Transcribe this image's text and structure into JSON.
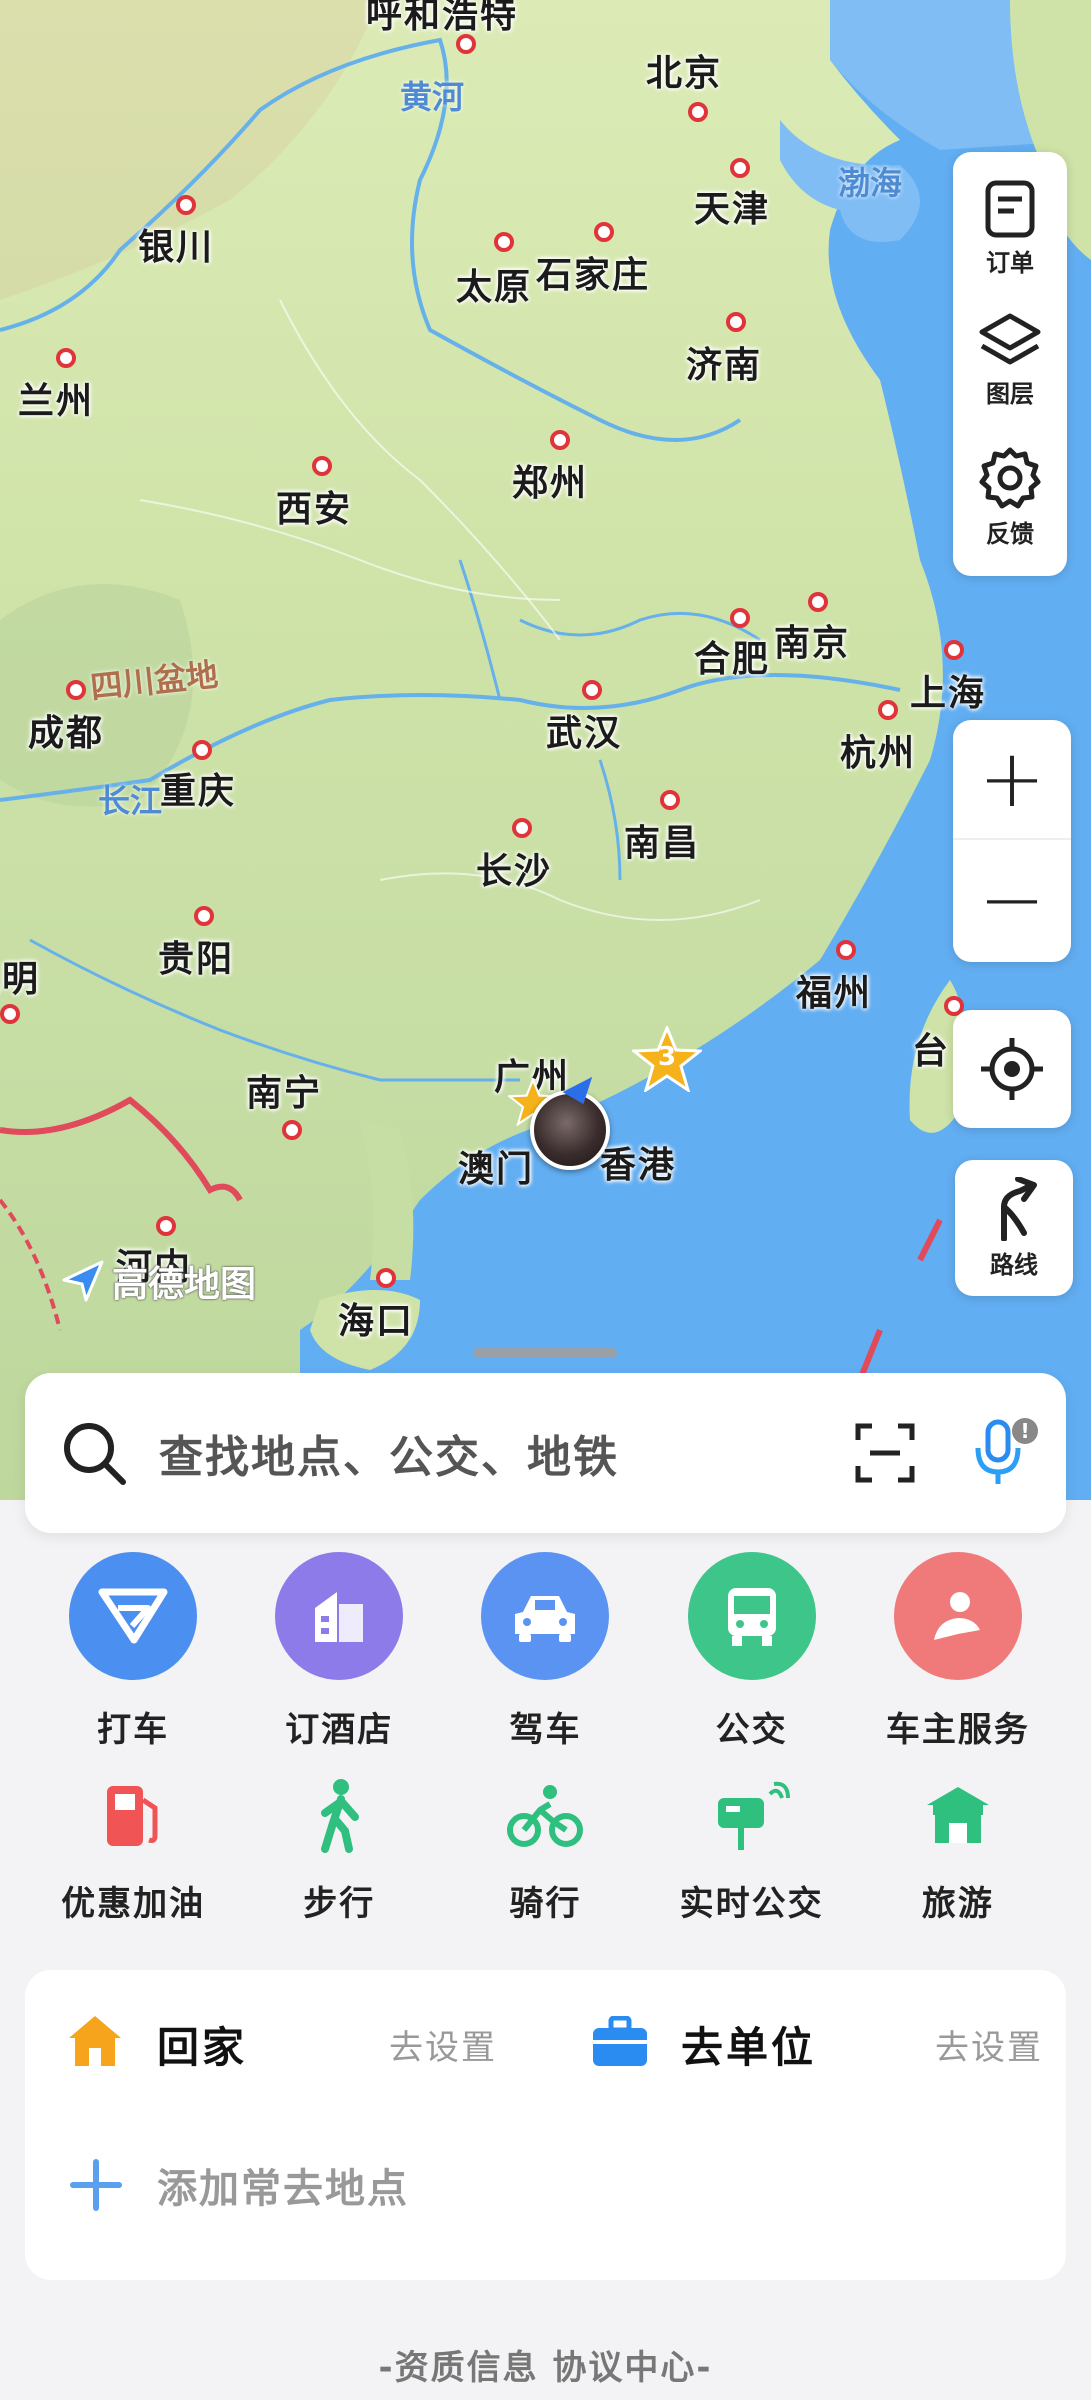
{
  "map": {
    "cities": [
      {
        "id": "huhehaote",
        "name": "呼和浩特"
      },
      {
        "id": "beijing",
        "name": "北京"
      },
      {
        "id": "tianjin",
        "name": "天津"
      },
      {
        "id": "yinchuan",
        "name": "银川"
      },
      {
        "id": "taiyuan",
        "name": "太原"
      },
      {
        "id": "shijiazhuang",
        "name": "石家庄"
      },
      {
        "id": "jinan",
        "name": "济南"
      },
      {
        "id": "lanzhou",
        "name": "兰州"
      },
      {
        "id": "xian",
        "name": "西安"
      },
      {
        "id": "zhengzhou",
        "name": "郑州"
      },
      {
        "id": "hefei",
        "name": "合肥"
      },
      {
        "id": "nanjing",
        "name": "南京"
      },
      {
        "id": "shanghai",
        "name": "上海"
      },
      {
        "id": "chengdu",
        "name": "成都"
      },
      {
        "id": "wuhan",
        "name": "武汉"
      },
      {
        "id": "hangzhou",
        "name": "杭州"
      },
      {
        "id": "chongqing",
        "name": "重庆"
      },
      {
        "id": "changsha",
        "name": "长沙"
      },
      {
        "id": "nanchang",
        "name": "南昌"
      },
      {
        "id": "guiyang",
        "name": "贵阳"
      },
      {
        "id": "fuzhou",
        "name": "福州"
      },
      {
        "id": "kunming",
        "name": "昆明"
      },
      {
        "id": "guangzhou",
        "name": "广州"
      },
      {
        "id": "taiwan",
        "name": "台"
      },
      {
        "id": "nanning",
        "name": "南宁"
      },
      {
        "id": "macau",
        "name": "澳门"
      },
      {
        "id": "hongkong",
        "name": "香港"
      },
      {
        "id": "hanoi",
        "name": "河内"
      },
      {
        "id": "haikou",
        "name": "海口"
      }
    ],
    "water_labels": {
      "yellow_river": "黄河",
      "bohai": "渤海",
      "yangtze": "长江"
    },
    "region_labels": {
      "sichuan_basin": "四川盆地"
    },
    "star_badge": "3",
    "logo_text": "高德地图"
  },
  "controls": {
    "orders": "订单",
    "layers": "图层",
    "feedback": "反馈",
    "zoom_in": "+",
    "zoom_out": "−",
    "route": "路线"
  },
  "search": {
    "placeholder": "查找地点、公交、地铁"
  },
  "services_row1": [
    {
      "label": "打车",
      "color": "#4b8ff0"
    },
    {
      "label": "订酒店",
      "color": "#8c7be8"
    },
    {
      "label": "驾车",
      "color": "#5b93f2"
    },
    {
      "label": "公交",
      "color": "#3ec58a"
    },
    {
      "label": "车主服务",
      "color": "#f07a7a"
    }
  ],
  "services_row2": [
    {
      "label": "优惠加油",
      "color": "#f05454"
    },
    {
      "label": "步行",
      "color": "#2fbf7e"
    },
    {
      "label": "骑行",
      "color": "#2fbf7e"
    },
    {
      "label": "实时公交",
      "color": "#2fbf7e"
    },
    {
      "label": "旅游",
      "color": "#2fbf7e"
    }
  ],
  "places": {
    "home": "回家",
    "home_set": "去设置",
    "work": "去单位",
    "work_set": "去设置",
    "add": "添加常去地点"
  },
  "footer": "-资质信息 协议中心-"
}
